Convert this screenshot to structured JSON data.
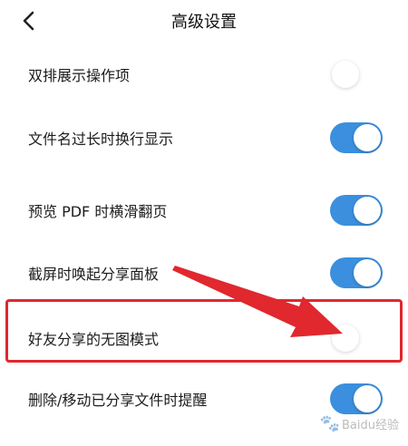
{
  "header": {
    "title": "高级设置",
    "back_icon": "chevron-left-icon"
  },
  "settings": [
    {
      "label": "双排展示操作项",
      "enabled": false
    },
    {
      "label": "文件名过长时换行显示",
      "enabled": true
    },
    {
      "label": "预览 PDF 时横滑翻页",
      "enabled": true
    },
    {
      "label": "截屏时唤起分享面板",
      "enabled": true
    },
    {
      "label": "好友分享的无图模式",
      "enabled": false
    },
    {
      "label": "删除/移动已分享文件时提醒",
      "enabled": true
    }
  ],
  "annotation": {
    "highlighted_item": "好友分享的无图模式",
    "color": "#e0282e"
  },
  "watermark": {
    "text": "Baidu经验"
  },
  "colors": {
    "toggle_on": "#3b8fde",
    "toggle_off": "#ffffff",
    "highlight": "#e0282e"
  }
}
